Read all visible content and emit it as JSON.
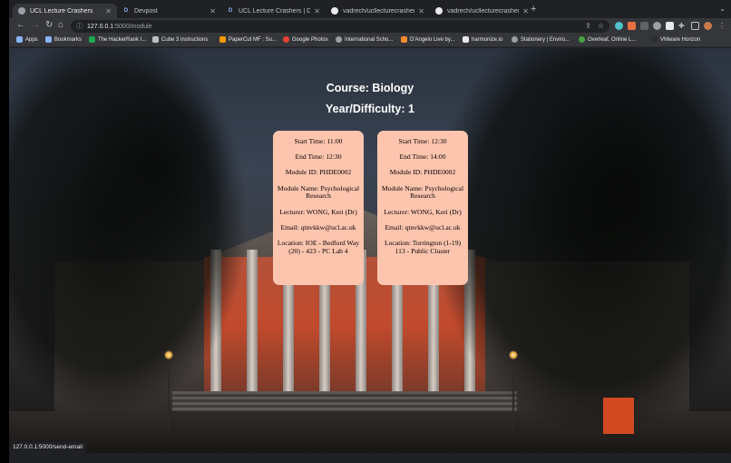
{
  "browser": {
    "tabs": [
      {
        "title": "UCL Lecture Crashers",
        "favicon": "globe-icon",
        "active": true
      },
      {
        "title": "Devpost",
        "favicon": "devpost-icon",
        "active": false
      },
      {
        "title": "UCL Lecture Crashers | Devpo",
        "favicon": "devpost-icon",
        "active": false
      },
      {
        "title": "vadrech/ucllecturecrashers",
        "favicon": "github-icon",
        "active": false
      },
      {
        "title": "vadrech/ucllecturecrashers",
        "favicon": "github-icon",
        "active": false
      }
    ],
    "new_tab": "+",
    "address": {
      "host": "127.0.0.1",
      "path": ":5000/module"
    },
    "bookmarks": [
      {
        "label": "Apps",
        "color": "#8ab4f8"
      },
      {
        "label": "Bookmarks",
        "color": "#8ab4f8"
      },
      {
        "label": "The HackerRank I...",
        "color": "#1ba94c"
      },
      {
        "label": "Cube 3 instructions",
        "color": "#bdc1c6"
      },
      {
        "label": "PaperCut MF : Su...",
        "color": "#f29900"
      },
      {
        "label": "Google Photos",
        "color": "#ea4335"
      },
      {
        "label": "International Scho...",
        "color": "#9aa0a6"
      },
      {
        "label": "D'Angelo Live by...",
        "color": "#f28b30"
      },
      {
        "label": "harmonize.io",
        "color": "#e8eaed"
      },
      {
        "label": "Stationery | Enviro...",
        "color": "#9aa0a6"
      },
      {
        "label": "Overleaf, Online L...",
        "color": "#47a141"
      },
      {
        "label": "VMware Horizon",
        "color": "#2b2d31"
      }
    ],
    "status_url": "127.0.0.1:5000/send-email"
  },
  "page": {
    "course_line": "Course: Biology",
    "year_line": "Year/Difficulty: 1",
    "cards": [
      {
        "start": "Start Time: 11:00",
        "end": "End Time: 12:30",
        "module_id": "Module ID: PHDE0002",
        "module_name": "Module Name: Psychological Research",
        "lecturer": "Lecturer: WONG, Keri (Dr)",
        "email": "Email: qtnvkkw@ucl.ac.uk",
        "location": "Location: IOE - Bedford Way (20) - 423 - PC Lab 4"
      },
      {
        "start": "Start Time: 12:30",
        "end": "End Time: 14:00",
        "module_id": "Module ID: PHDE0002",
        "module_name": "Module Name: Psychological Research",
        "lecturer": "Lecturer: WONG, Keri (Dr)",
        "email": "Email: qtnvkkw@ucl.ac.uk",
        "location": "Location: Torrington (1-19) 113 - Public Cluster"
      }
    ],
    "card_color": "#fec5ae"
  }
}
